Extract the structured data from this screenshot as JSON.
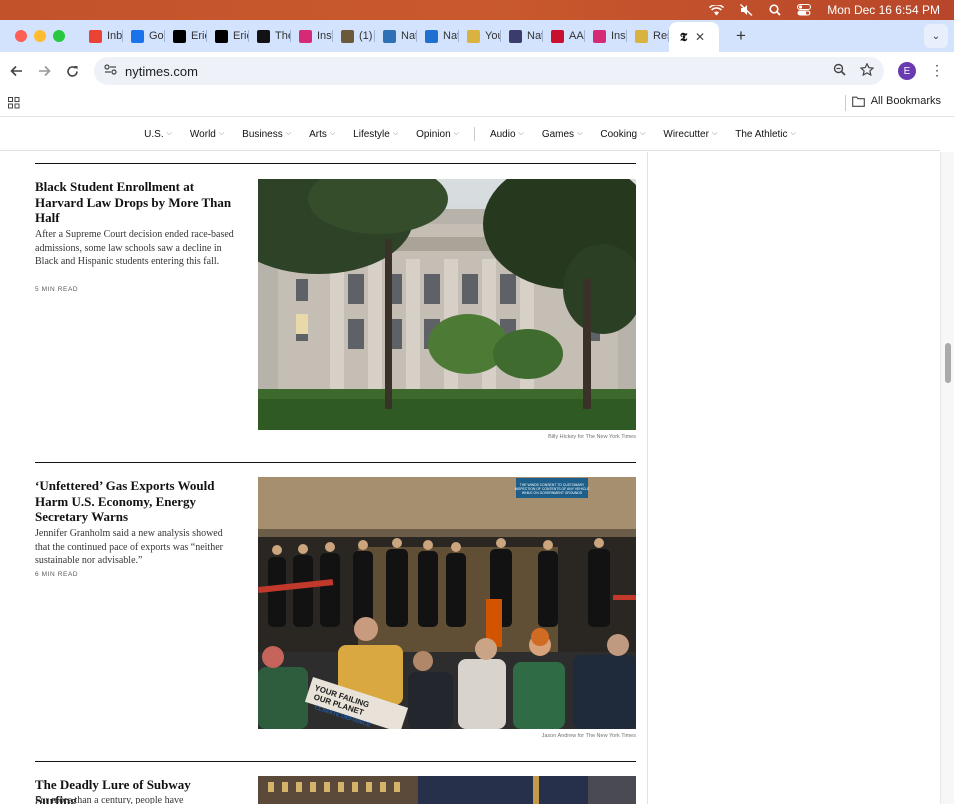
{
  "menubar": {
    "datetime": "Mon Dec 16  6:54 PM"
  },
  "tabs": [
    {
      "label": "Inb",
      "favicon": "gmail-icon",
      "color": "#ea4335"
    },
    {
      "label": "Goo",
      "favicon": "calendar-icon",
      "color": "#1a73e8"
    },
    {
      "label": "Eric",
      "favicon": "x-icon",
      "color": "#000000"
    },
    {
      "label": "Eric",
      "favicon": "x-icon",
      "color": "#000000"
    },
    {
      "label": "The",
      "favicon": "nyt-icon",
      "color": "#121212"
    },
    {
      "label": "Inst",
      "favicon": "instagram-icon",
      "color": "#d62976"
    },
    {
      "label": "(1)",
      "favicon": "bag-icon",
      "color": "#6b5a3a"
    },
    {
      "label": "Nat",
      "favicon": "person-icon",
      "color": "#2f6fb5"
    },
    {
      "label": "Nat",
      "favicon": "shield-icon",
      "color": "#1f6fd1"
    },
    {
      "label": "You",
      "favicon": "sun-icon",
      "color": "#d9b23f"
    },
    {
      "label": "Nat",
      "favicon": "flag-icon",
      "color": "#3c3b6e"
    },
    {
      "label": "AAI",
      "favicon": "aa-icon",
      "color": "#c8102e"
    },
    {
      "label": "Inst",
      "favicon": "instagram-icon",
      "color": "#d62976"
    },
    {
      "label": "Res",
      "favicon": "sun-icon",
      "color": "#d9b23f"
    }
  ],
  "active_tab": {
    "favicon": "nyt-icon",
    "close": "✕"
  },
  "newtab": "+",
  "address": {
    "url": "nytimes.com"
  },
  "profile": {
    "initial": "E",
    "color": "#6a3ab2"
  },
  "bookmarks": {
    "all_label": "All Bookmarks"
  },
  "nyt_nav": {
    "group1": [
      "U.S.",
      "World",
      "Business",
      "Arts",
      "Lifestyle",
      "Opinion"
    ],
    "group2": [
      "Audio",
      "Games",
      "Cooking",
      "Wirecutter",
      "The Athletic"
    ]
  },
  "articles": [
    {
      "headline": "Black Student Enrollment at Harvard Law Drops by More Than Half",
      "summary": "After a Supreme Court decision ended race-based admissions, some law schools saw a decline in Black and Hispanic students entering this fall.",
      "read_time": "5 MIN READ",
      "credit": "Billy Hickey for The New York Times"
    },
    {
      "headline": "‘Unfettered’ Gas Exports Would Harm U.S. Economy, Energy Secretary Warns",
      "summary": "Jennifer Granholm said a new analysis showed that the continued pace of exports was “neither sustainable nor advisable.”",
      "read_time": "6 MIN READ",
      "credit": "Jason Andrew for The New York Times"
    },
    {
      "headline": "The Deadly Lure of Subway Surfing",
      "summary": "For more than a century, people have",
      "read_time": "",
      "credit": ""
    }
  ],
  "photo2_text": {
    "sign": "THE WINDS CONSENT TO CUSTOMARY INSPECTION OF CONTENTS OF ANY VEHICLE WHILE ON GOVERNMENT GROUNDS",
    "banner": "YOUR FAILING OUR PLANET CLIMATE DEFIANCE"
  }
}
